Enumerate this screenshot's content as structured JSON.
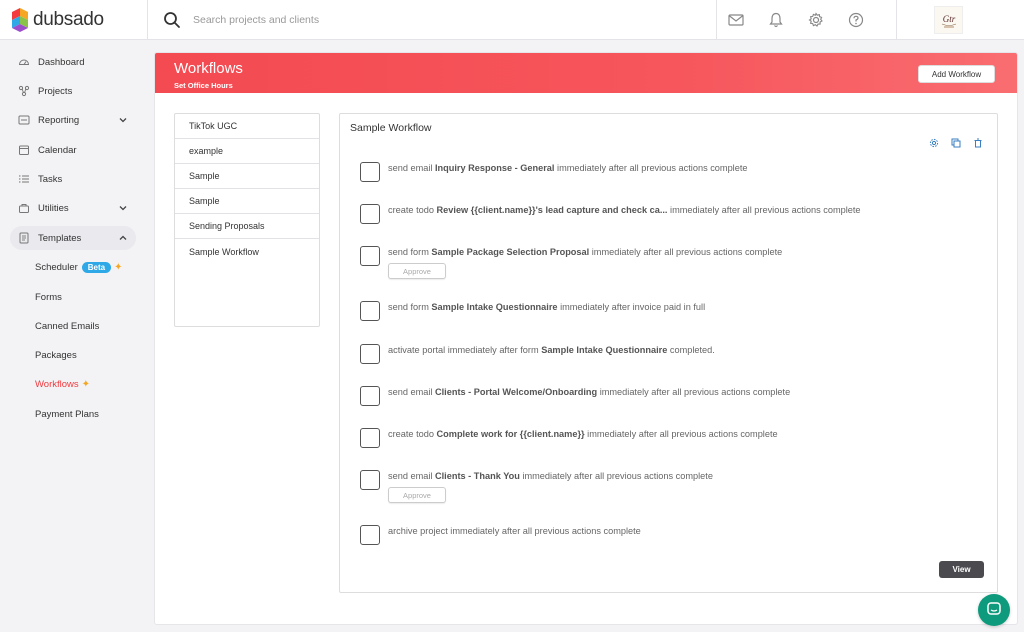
{
  "app": {
    "name": "dubsado"
  },
  "search": {
    "placeholder": "Search projects and clients"
  },
  "sidebar": {
    "items": [
      {
        "label": "Dashboard"
      },
      {
        "label": "Projects"
      },
      {
        "label": "Reporting"
      },
      {
        "label": "Calendar"
      },
      {
        "label": "Tasks"
      },
      {
        "label": "Utilities"
      },
      {
        "label": "Templates"
      }
    ],
    "sub_items": [
      {
        "label": "Scheduler",
        "badge": "Beta"
      },
      {
        "label": "Forms"
      },
      {
        "label": "Canned Emails"
      },
      {
        "label": "Packages"
      },
      {
        "label": "Workflows"
      },
      {
        "label": "Payment Plans"
      }
    ]
  },
  "header": {
    "title": "Workflows",
    "subtitle": "Set Office Hours",
    "add_button": "Add Workflow"
  },
  "workflows": [
    "TikTok UGC",
    "example",
    "Sample",
    "Sample",
    "Sending Proposals",
    "Sample Workflow"
  ],
  "detail": {
    "title": "Sample Workflow",
    "approve_label": "Approve",
    "view_label": "View",
    "actions": [
      {
        "pre": "send email ",
        "bold": "Inquiry Response - General",
        "post": " immediately after all previous actions complete"
      },
      {
        "pre": "create todo ",
        "bold": "Review {{client.name}}'s lead capture and check ca...",
        "post": " immediately after all previous actions complete"
      },
      {
        "pre": "send form ",
        "bold": "Sample Package Selection Proposal",
        "post": " immediately after all previous actions complete"
      },
      {
        "pre": "send form ",
        "bold": "Sample Intake Questionnaire",
        "post": " immediately after invoice paid in full"
      },
      {
        "pre": "activate portal immediately after form ",
        "bold": "Sample Intake Questionnaire",
        "post": " completed."
      },
      {
        "pre": "send email ",
        "bold": "Clients - Portal Welcome/Onboarding",
        "post": " immediately after all previous actions complete"
      },
      {
        "pre": "create todo ",
        "bold": "Complete work for {{client.name}}",
        "post": " immediately after all previous actions complete"
      },
      {
        "pre": "send email ",
        "bold": "Clients - Thank You",
        "post": " immediately after all previous actions complete"
      },
      {
        "pre": "archive project immediately after all previous actions complete",
        "bold": "",
        "post": ""
      }
    ]
  },
  "colors": {
    "accent": "#f23a3f",
    "beta": "#2ea8e6",
    "chat": "#0e9a7c"
  }
}
